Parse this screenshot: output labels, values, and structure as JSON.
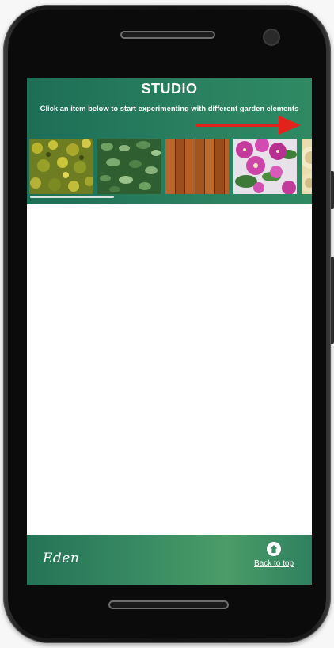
{
  "studio": {
    "title": "STUDIO",
    "subtitle": "Click an item below to start experimenting with different garden elements"
  },
  "carousel": {
    "items": [
      {
        "icon": "yellow-shrub-texture"
      },
      {
        "icon": "green-hedge-texture"
      },
      {
        "icon": "wood-fence-texture"
      },
      {
        "icon": "pink-bougainvillea-texture"
      },
      {
        "icon": "cream-rose-texture"
      }
    ],
    "scroll_position": 0.3
  },
  "footer": {
    "logo": "Eden",
    "back_to_top": "Back to top"
  },
  "colors": {
    "header_green": "#1d6e55",
    "footer_green": "#3b8d64",
    "arrow_red": "#e3231b"
  }
}
